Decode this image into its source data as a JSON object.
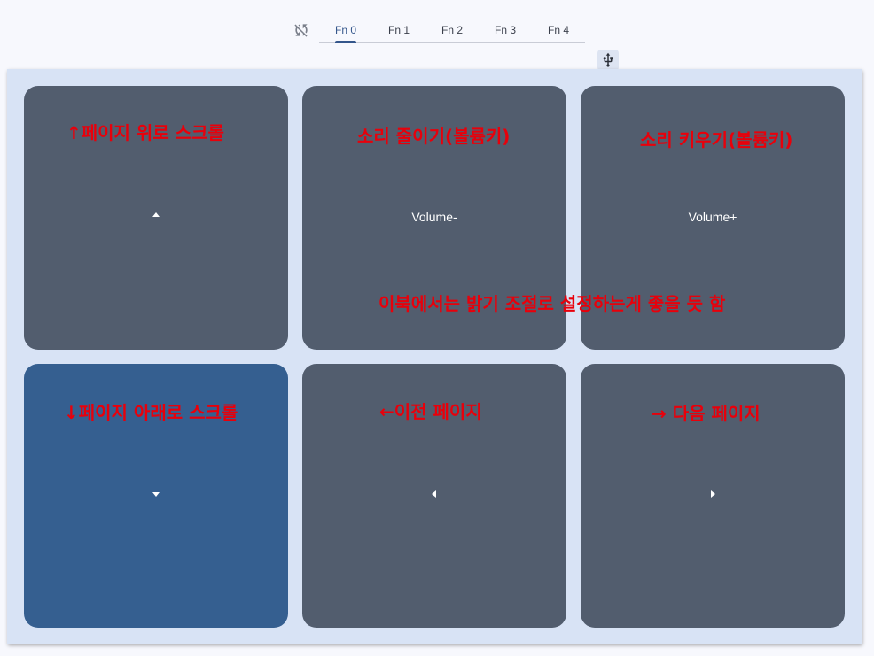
{
  "tabs": [
    {
      "label": "Fn 0",
      "active": true
    },
    {
      "label": "Fn 1",
      "active": false
    },
    {
      "label": "Fn 2",
      "active": false
    },
    {
      "label": "Fn 3",
      "active": false
    },
    {
      "label": "Fn 4",
      "active": false
    }
  ],
  "icons": {
    "sync": "sync-disabled-icon",
    "usb": "usb-icon"
  },
  "keys": [
    {
      "label": "",
      "icon": "arrow-up-icon",
      "selected": false
    },
    {
      "label": "Volume-",
      "icon": "",
      "selected": false
    },
    {
      "label": "Volume+",
      "icon": "",
      "selected": false
    },
    {
      "label": "",
      "icon": "arrow-down-icon",
      "selected": true
    },
    {
      "label": "",
      "icon": "arrow-left-icon",
      "selected": false
    },
    {
      "label": "",
      "icon": "arrow-right-icon",
      "selected": false
    }
  ],
  "annotations": {
    "scroll_up": "↑페이지 위로 스크롤",
    "volume_down": "소리 줄이기(볼륨키)",
    "volume_up": "소리 키우기(볼륨키)",
    "ebook_note": "이북에서는 밝기 조절로 설정하는게 좋을 듯 함",
    "scroll_down": "↓페이지 아래로 스크롤",
    "prev_page": "←이전 페이지",
    "next_page": "→ 다음 페이지"
  },
  "colors": {
    "key": "#525d6e",
    "key_selected": "#355f90",
    "panel": "#d8e3f5",
    "accent": "#34568b",
    "annotation": "#e8000b"
  }
}
